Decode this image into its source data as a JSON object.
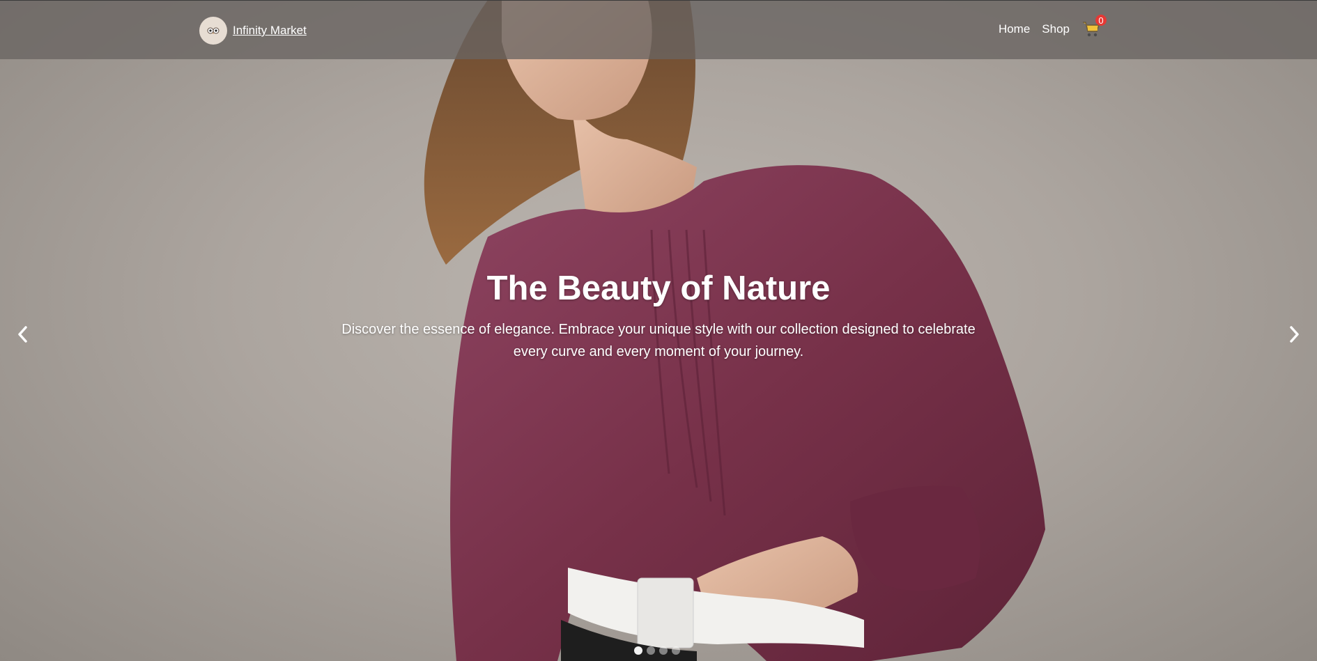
{
  "brand": {
    "name": "Infinity Market",
    "logo_icon": "owl-icon"
  },
  "nav": {
    "links": [
      {
        "label": "Home"
      },
      {
        "label": "Shop"
      }
    ],
    "cart": {
      "icon": "cart-icon",
      "count": "0"
    }
  },
  "hero": {
    "title": "The Beauty of Nature",
    "description": "Discover the essence of elegance. Embrace your unique style with our collection designed to celebrate every curve and every moment of your journey.",
    "prev_icon": "chevron-left-icon",
    "next_icon": "chevron-right-icon",
    "slides_count": 4,
    "active_slide": 1
  },
  "colors": {
    "navbar_bg": "#69645f",
    "blouse": "#7c3550",
    "badge": "#e53935",
    "text": "#ffffff"
  }
}
